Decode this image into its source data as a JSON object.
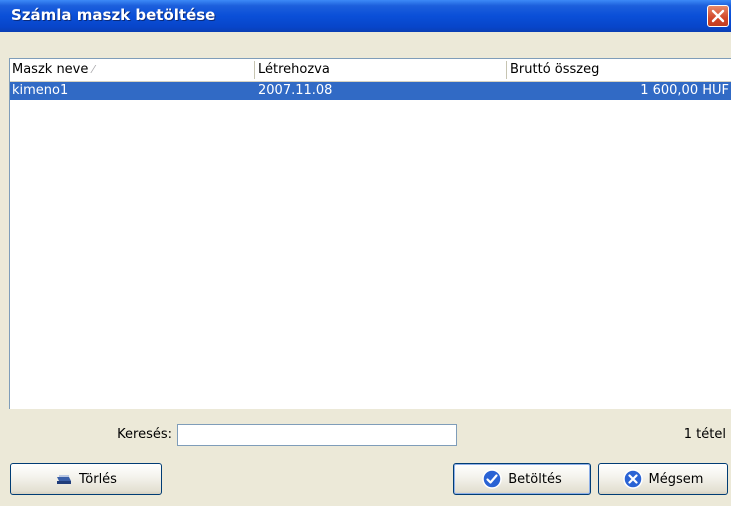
{
  "window": {
    "title": "Számla maszk betöltése",
    "close_icon": "close-icon"
  },
  "list": {
    "columns": [
      {
        "label": "Maszk neve",
        "sorted": "ascending"
      },
      {
        "label": "Létrehozva"
      },
      {
        "label": "Bruttó összeg"
      }
    ],
    "rows": [
      {
        "name": "kimeno1",
        "created": "2007.11.08",
        "amount": "1 600,00 HUF",
        "selected": true
      }
    ]
  },
  "search": {
    "label": "Keresés:",
    "value": "",
    "count": "1 tétel"
  },
  "buttons": {
    "delete": {
      "label": "Törlés",
      "icon": "eraser-icon"
    },
    "load": {
      "label": "Betöltés",
      "icon": "check-circle-icon"
    },
    "cancel": {
      "label": "Mégsem",
      "icon": "x-circle-icon"
    }
  },
  "colors": {
    "titlebar": "#0a4fd8",
    "selection": "#316ac5",
    "close_button": "#d2472a",
    "dialog_bg": "#ece9d8"
  }
}
